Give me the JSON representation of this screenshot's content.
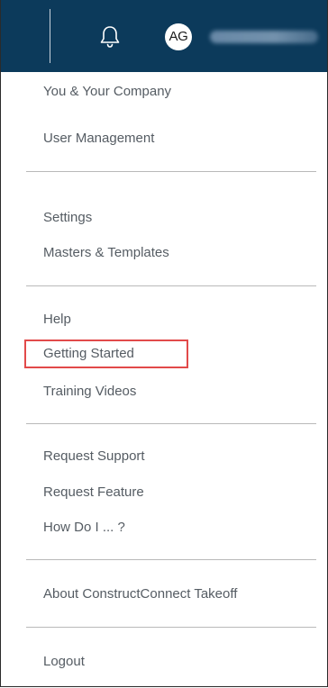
{
  "header": {
    "avatar_initials": "AG",
    "bell_icon": "bell-icon"
  },
  "menu": {
    "you_and_company": "You & Your Company",
    "user_management": "User Management",
    "settings": "Settings",
    "masters_templates": "Masters & Templates",
    "help": "Help",
    "getting_started": "Getting Started",
    "training_videos": "Training Videos",
    "request_support": "Request Support",
    "request_feature": "Request Feature",
    "how_do_i": "How Do I ... ?",
    "about": "About ConstructConnect Takeoff",
    "logout": "Logout"
  },
  "colors": {
    "header_bg": "#0c3a5b",
    "highlight_border": "#e24a4a",
    "menu_text": "#555c63"
  }
}
